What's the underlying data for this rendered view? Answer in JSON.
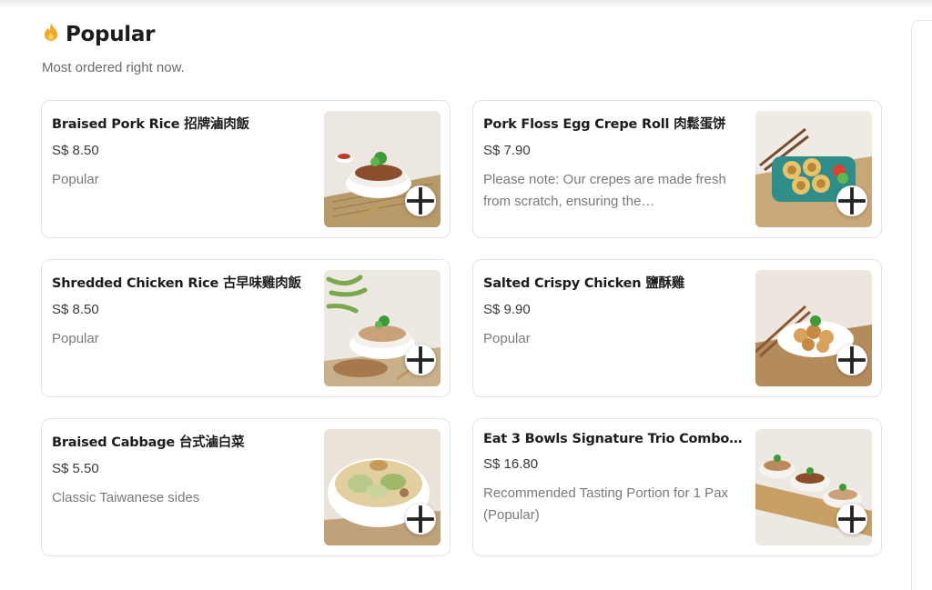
{
  "section": {
    "icon": "fire-icon",
    "title": "Popular",
    "subtitle": "Most ordered right now."
  },
  "items": [
    {
      "name": "Braised Pork Rice 招牌滷肉飯",
      "price": "S$ 8.50",
      "desc": "Popular",
      "image": "braised-pork-rice-photo"
    },
    {
      "name": "Pork Floss Egg Crepe Roll 肉鬆蛋饼",
      "price": "S$ 7.90",
      "desc": "Please note: Our crepes are made fresh from scratch, ensuring the…",
      "image": "pork-floss-crepe-photo"
    },
    {
      "name": "Shredded Chicken Rice 古早味雞肉飯",
      "price": "S$ 8.50",
      "desc": "Popular",
      "image": "shredded-chicken-rice-photo"
    },
    {
      "name": "Salted Crispy Chicken 鹽酥雞",
      "price": "S$ 9.90",
      "desc": "Popular",
      "image": "salted-crispy-chicken-photo"
    },
    {
      "name": "Braised Cabbage 台式滷白菜",
      "price": "S$ 5.50",
      "desc": "Classic Taiwanese sides",
      "image": "braised-cabbage-photo"
    },
    {
      "name": "Eat 3 Bowls Signature Trio Combo ...",
      "price": "S$ 16.80",
      "desc": "Recommended Tasting Portion for 1 Pax (Popular)",
      "image": "trio-combo-photo"
    }
  ],
  "colors": {
    "accent": "#f5a623",
    "border": "#e3e3e3",
    "muted": "#7a7a7a"
  }
}
